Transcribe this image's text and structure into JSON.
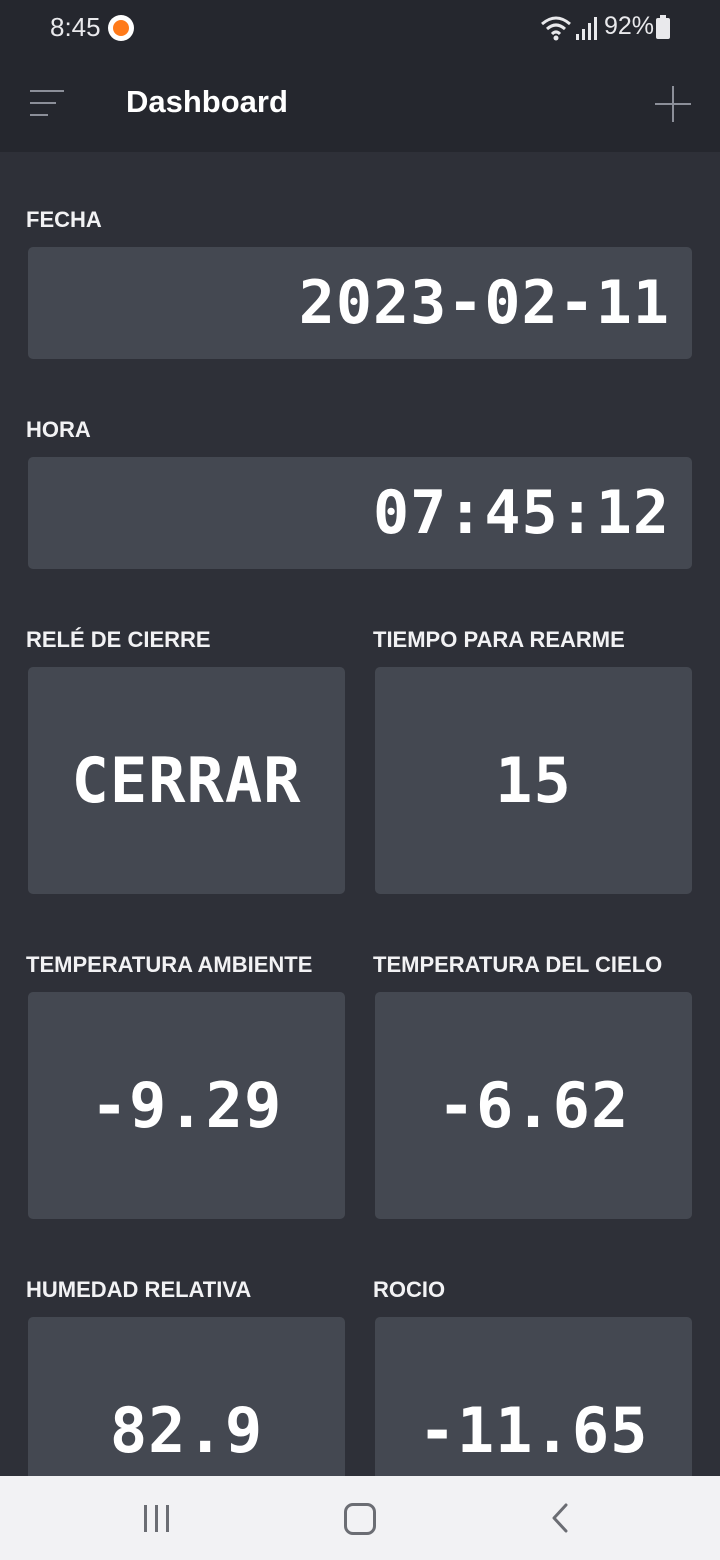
{
  "status_bar": {
    "time": "8:45",
    "battery": "92%"
  },
  "app_bar": {
    "title": "Dashboard"
  },
  "widgets": {
    "fecha": {
      "label": "FECHA",
      "value": "2023-02-11"
    },
    "hora": {
      "label": "HORA",
      "value": "07:45:12"
    },
    "rele": {
      "label": "RELÉ DE CIERRE",
      "value": "CERRAR"
    },
    "tiempo": {
      "label": "TIEMPO PARA REARME",
      "value": "15"
    },
    "temp_ambiente": {
      "label": "TEMPERATURA AMBIENTE",
      "value": "-9.29"
    },
    "temp_cielo": {
      "label": "TEMPERATURA DEL CIELO",
      "value": "-6.62"
    },
    "humedad": {
      "label": "HUMEDAD RELATIVA",
      "value": "82.9"
    },
    "rocio": {
      "label": "ROCIO",
      "value": "-11.65"
    }
  },
  "icons": {
    "status": [
      "notification-icon",
      "wifi-icon",
      "signal-icon",
      "battery-icon"
    ],
    "app_bar": [
      "menu-icon",
      "add-icon"
    ],
    "nav": [
      "recent-apps-icon",
      "home-icon",
      "back-icon"
    ]
  },
  "colors": {
    "background": "#2e3038",
    "bar": "#25272e",
    "card": "#444851",
    "nav_bar": "#f2f2f4"
  }
}
